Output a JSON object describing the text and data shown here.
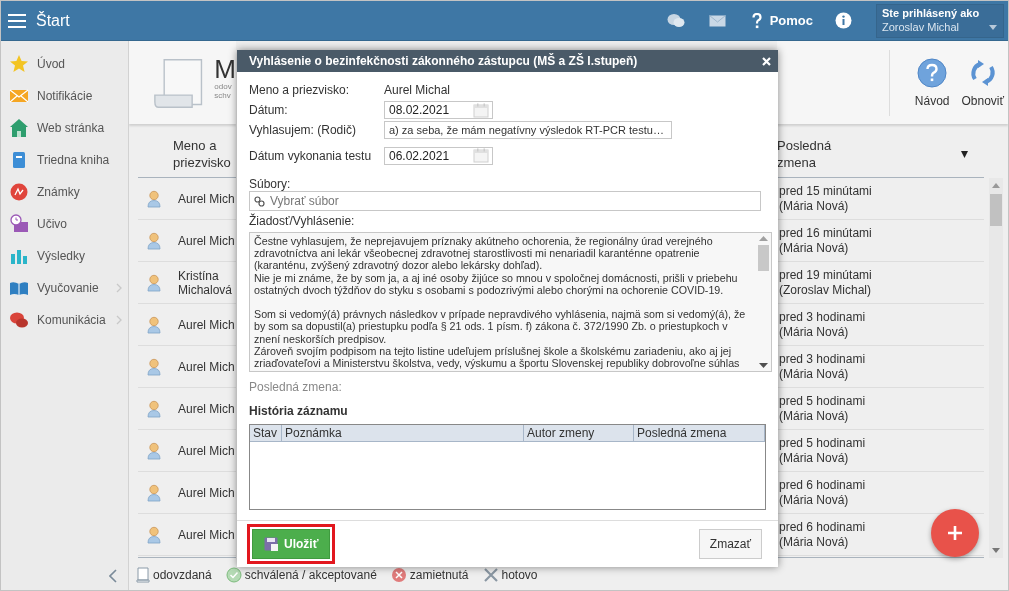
{
  "topbar": {
    "title": "Štart",
    "help": "Pomoc",
    "user_label": "Ste prihlásený ako",
    "user_name": "Zoroslav Michal"
  },
  "sidebar": {
    "items": [
      {
        "label": "Úvod",
        "kind": "star",
        "has_children": false
      },
      {
        "label": "Notifikácie",
        "kind": "envelope",
        "has_children": false
      },
      {
        "label": "Web stránka",
        "kind": "house",
        "has_children": false
      },
      {
        "label": "Triedna kniha",
        "kind": "book",
        "has_children": false
      },
      {
        "label": "Známky",
        "kind": "grade",
        "has_children": false
      },
      {
        "label": "Učivo",
        "kind": "clock",
        "has_children": false
      },
      {
        "label": "Výsledky",
        "kind": "chart",
        "has_children": false
      },
      {
        "label": "Vyučovanie",
        "kind": "openbook",
        "has_children": true
      },
      {
        "label": "Komunikácia",
        "kind": "chat",
        "has_children": true
      }
    ]
  },
  "page_header": {
    "title": "M",
    "subtitle_lines": [
      "odov",
      "schv"
    ],
    "actions": [
      {
        "label": "Návod",
        "kind": "help"
      },
      {
        "label": "Obnoviť",
        "kind": "refresh"
      }
    ]
  },
  "table": {
    "columns": [
      {
        "label": "Meno a priezvisko",
        "sorted": false
      },
      {
        "label": "Posledná zmena",
        "sorted": true
      }
    ],
    "rows": [
      {
        "name": "Aurel Mich",
        "last_change": "pred 15 minútami",
        "author": "(Mária Nová)"
      },
      {
        "name": "Aurel Mich",
        "last_change": "pred 16 minútami",
        "author": "(Mária Nová)"
      },
      {
        "name": "Kristína Michalová",
        "last_change": "pred 19 minútami",
        "author": "(Zoroslav Michal)"
      },
      {
        "name": "Aurel Mich",
        "last_change": "pred 3 hodinami",
        "author": "(Mária Nová)"
      },
      {
        "name": "Aurel Mich",
        "last_change": "pred 3 hodinami",
        "author": "(Mária Nová)"
      },
      {
        "name": "Aurel Mich",
        "last_change": "pred 5 hodinami",
        "author": "(Mária Nová)"
      },
      {
        "name": "Aurel Mich",
        "last_change": "pred 5 hodinami",
        "author": "(Mária Nová)"
      },
      {
        "name": "Aurel Mich",
        "last_change": "pred 6 hodinami",
        "author": "(Mária Nová)"
      },
      {
        "name": "Aurel Mich",
        "last_change": "pred 6 hodinami",
        "author": "(Mária Nová)"
      }
    ]
  },
  "legend": [
    {
      "label": "odovzdaná",
      "kind": "submitted"
    },
    {
      "label": "schválená / akceptované",
      "kind": "approved"
    },
    {
      "label": "zamietnutá",
      "kind": "rejected"
    },
    {
      "label": "hotovo",
      "kind": "done"
    }
  ],
  "dialog": {
    "title": "Vyhlásenie o bezinfekčnosti zákonného zástupcu (MŠ a ZŠ I.stupeň)",
    "fields": [
      {
        "label": "Meno a priezvisko:",
        "kind": "text",
        "value": "Aurel Michal"
      },
      {
        "label": "Dátum:",
        "kind": "date",
        "value": "08.02.2021"
      },
      {
        "label": "Vyhlasujem: (Rodič)",
        "kind": "select",
        "value": "a) za seba, že mám negatívny výsledok RT-PCR testu…"
      },
      {
        "label": "Dátum vykonania testu",
        "kind": "date",
        "value": "06.02.2021"
      }
    ],
    "files": {
      "label": "Súbory:",
      "placeholder": "Vybrať súbor"
    },
    "statement": {
      "label": "Žiadosť/Vyhlásenie:",
      "text": "Čestne vyhlasujem, že neprejavujem príznaky akútneho ochorenia, že regionálny úrad verejného zdravotníctva ani lekár všeobecnej zdravotnej starostlivosti mi nenariadil karanténne opatrenie (karanténu, zvýšený zdravotný dozor alebo lekársky dohľad).\nNie je mi známe, že by som ja, a aj iné osoby žijúce so mnou v spoločnej domácnosti, prišli v priebehu ostatných dvoch týždňov do styku s osobami s podozrivými alebo chorými na ochorenie COVID-19.\n\nSom si vedomý(á) právnych následkov v prípade nepravdivého vyhlásenia, najmä som si vedomý(á), že by som sa dopustil(a) priestupku podľa § 21 ods. 1 písm. f) zákona č. 372/1990 Zb. o priestupkoch v znení neskorších predpisov.\nZároveň svojím podpisom na tejto listine udeľujem príslušnej škole a školskému zariadeniu, ako aj jej zriaďovateľovi a Ministerstvu školstva, vedy, výskumu a športu Slovenskej republiky dobrovoľne súhlas"
    },
    "last_change_label": "Posledná zmena:",
    "history": {
      "title": "História záznamu",
      "columns": [
        "Stav",
        "Poznámka",
        "Autor zmeny",
        "Posledná zmena"
      ]
    },
    "buttons": [
      {
        "label": "Uložiť",
        "kind": "primary",
        "highlighted": true
      },
      {
        "label": "Zmazať",
        "kind": "secondary",
        "highlighted": false
      }
    ]
  }
}
